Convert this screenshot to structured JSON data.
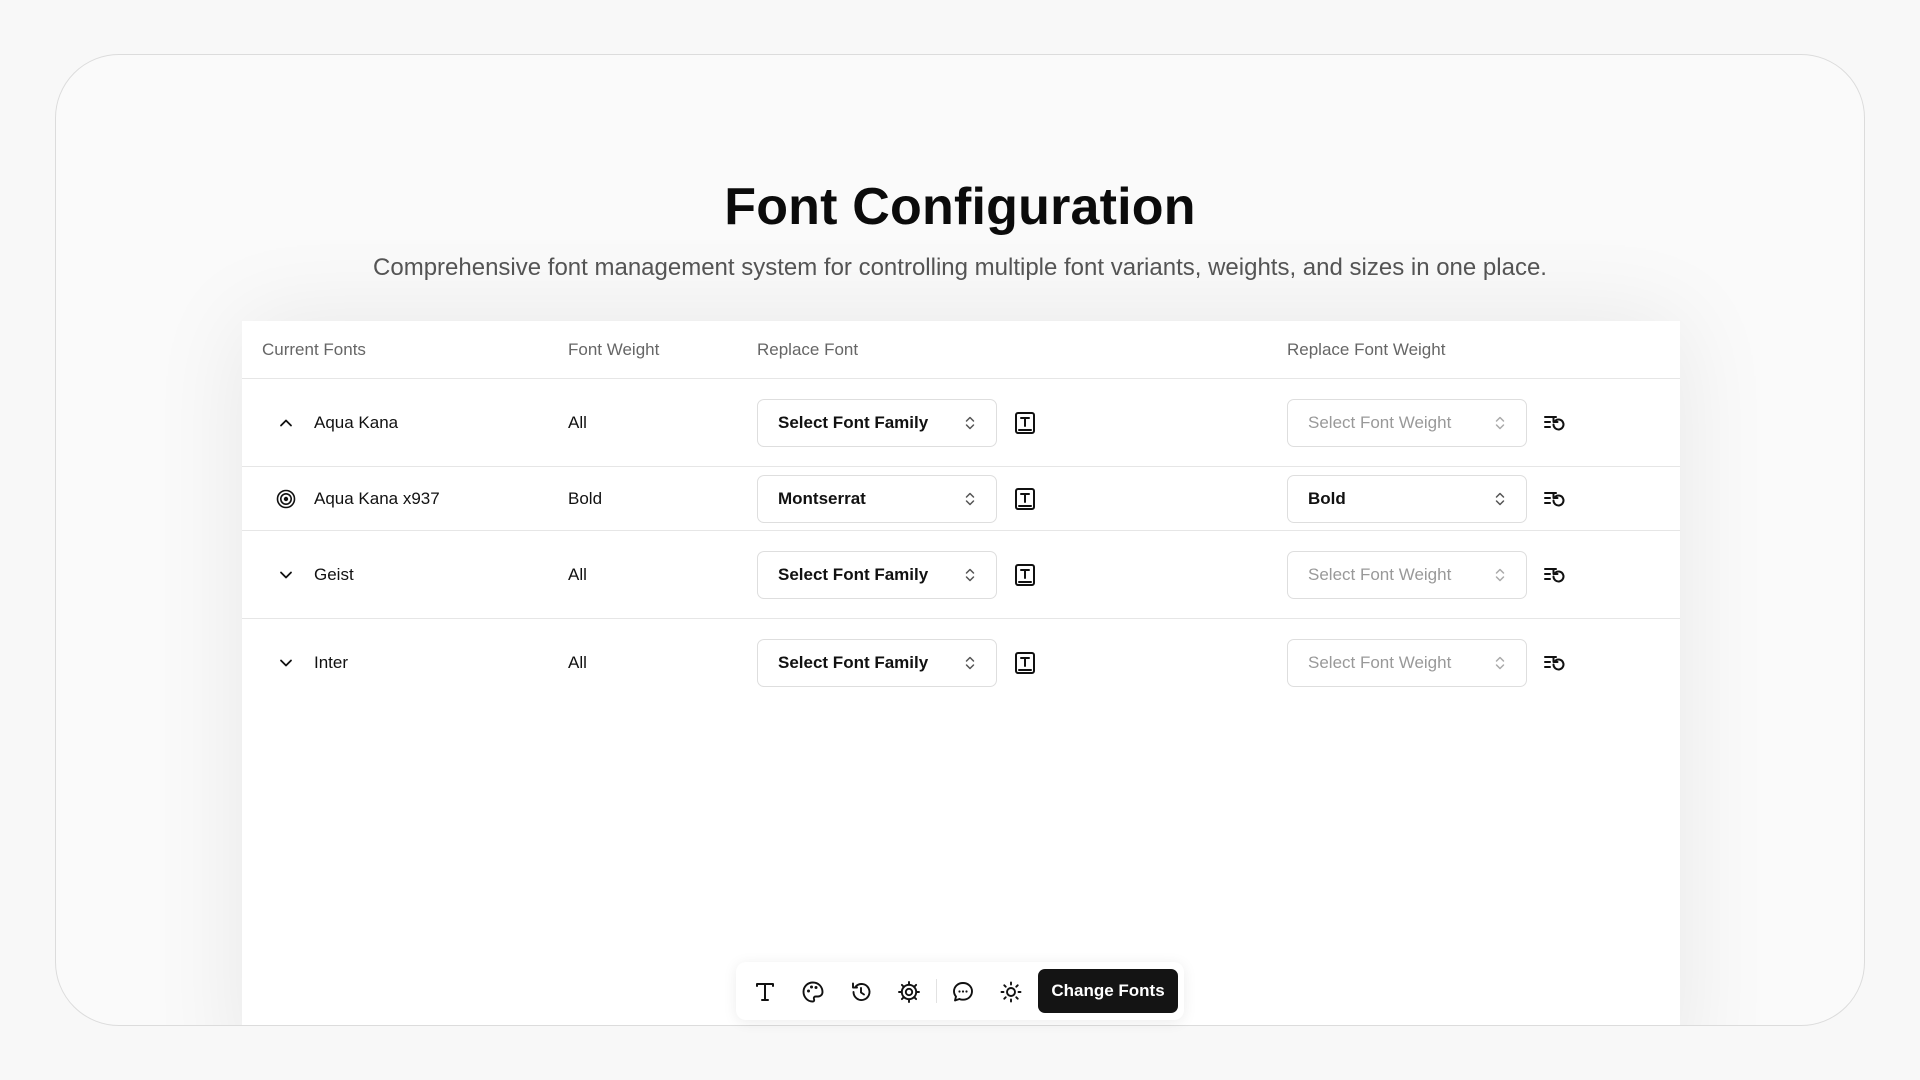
{
  "page": {
    "title": "Font Configuration",
    "subtitle": "Comprehensive font management system for controlling multiple font variants, weights, and sizes in one place."
  },
  "table": {
    "headers": {
      "current_fonts": "Current Fonts",
      "font_weight": "Font Weight",
      "replace_font": "Replace Font",
      "replace_font_weight": "Replace Font Weight"
    },
    "rows": [
      {
        "lead_icon": "chevron-up-icon",
        "name": "Aqua Kana",
        "weight": "All",
        "family_select": "Select Font Family",
        "weight_select": "Select Font Weight",
        "weight_filled": false
      },
      {
        "lead_icon": "target-icon",
        "name": "Aqua Kana x937",
        "weight": "Bold",
        "family_select": "Montserrat",
        "weight_select": "Bold",
        "weight_filled": true
      },
      {
        "lead_icon": "chevron-down-icon",
        "name": "Geist",
        "weight": "All",
        "family_select": "Select Font Family",
        "weight_select": "Select Font Weight",
        "weight_filled": false
      },
      {
        "lead_icon": "chevron-down-icon",
        "name": "Inter",
        "weight": "All",
        "family_select": "Select Font Family",
        "weight_select": "Select Font Weight",
        "weight_filled": false
      }
    ],
    "row_action_icons": [
      "font-replace-icon",
      "reset-list-icon"
    ]
  },
  "toolbar": {
    "icons": [
      "text-icon",
      "palette-icon",
      "history-icon",
      "gear-icon",
      "chat-icon",
      "sun-icon"
    ],
    "primary_label": "Change Fonts"
  },
  "colors": {
    "primary_button": "#141414",
    "background": "#f8f8f8",
    "card": "#ffffff",
    "border": "#e6e6e6"
  }
}
